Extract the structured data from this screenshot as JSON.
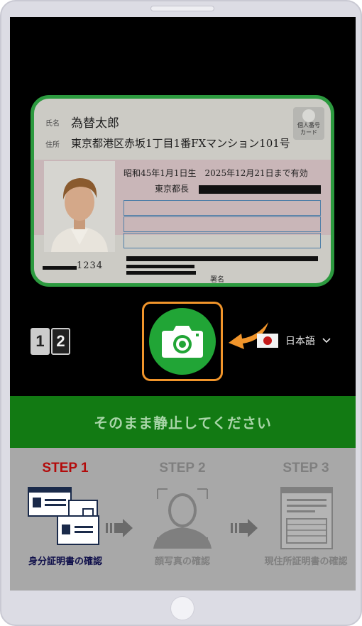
{
  "card": {
    "name_label": "氏名",
    "name": "為替太郎",
    "address_label": "住所",
    "address": "東京都港区赤坂1丁目1番FXマンション101号",
    "mark_line1": "個人番号",
    "mark_line2": "カード",
    "dob_expiry": "昭和45年1月1日生　2025年12月21日まで有効",
    "issuer": "東京都長",
    "number_suffix": "1234",
    "signature_label": "署名"
  },
  "controls": {
    "page_1": "1",
    "page_2": "2",
    "language": "日本語",
    "chevron": "⌄"
  },
  "banner": {
    "message": "そのまま静止してください"
  },
  "steps": [
    {
      "title": "STEP 1",
      "label": "身分証明書の確認",
      "status": "active"
    },
    {
      "title": "STEP 2",
      "label": "顔写真の確認",
      "status": "inactive"
    },
    {
      "title": "STEP 3",
      "label": "現住所証明書の確認",
      "status": "inactive"
    }
  ],
  "colors": {
    "frame_green": "#2c9a3f",
    "capture_green": "#21a536",
    "highlight_orange": "#f1952b",
    "banner_green": "#127a13",
    "active_step_red": "#b30b0b",
    "active_label_navy": "#0f0f4a"
  },
  "icons": {
    "capture": "camera-icon",
    "pointer": "curved-arrow-icon",
    "language": "japan-flag-icon",
    "step1": "id-cards-icon",
    "step2": "face-scan-icon",
    "step3": "document-icon"
  }
}
